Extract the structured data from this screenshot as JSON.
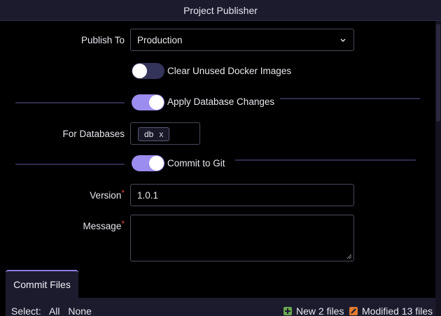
{
  "window": {
    "title": "Project Publisher"
  },
  "form": {
    "publish_to": {
      "label": "Publish To",
      "value": "Production"
    },
    "clear_docker": {
      "label": "Clear Unused Docker Images",
      "on": false
    },
    "apply_db": {
      "label": "Apply Database Changes",
      "on": true
    },
    "for_databases": {
      "label": "For Databases",
      "tags": [
        "db"
      ],
      "remove_glyph": "x"
    },
    "commit_git": {
      "label": "Commit to Git",
      "on": true
    },
    "version": {
      "label": "Version",
      "required_mark": "*",
      "value": "1.0.1"
    },
    "message": {
      "label": "Message",
      "required_mark": "*",
      "value": ""
    }
  },
  "tabs": {
    "commit_files": "Commit Files"
  },
  "files": {
    "select_label": "Select:",
    "select_all": "All",
    "select_none": "None",
    "new_files": "New 2 files",
    "modified_files": "Modified 13 files"
  },
  "colors": {
    "accent": "#9b8cf0",
    "required": "#e0453a",
    "new": "#6aa84f",
    "modified": "#e07a2e"
  }
}
